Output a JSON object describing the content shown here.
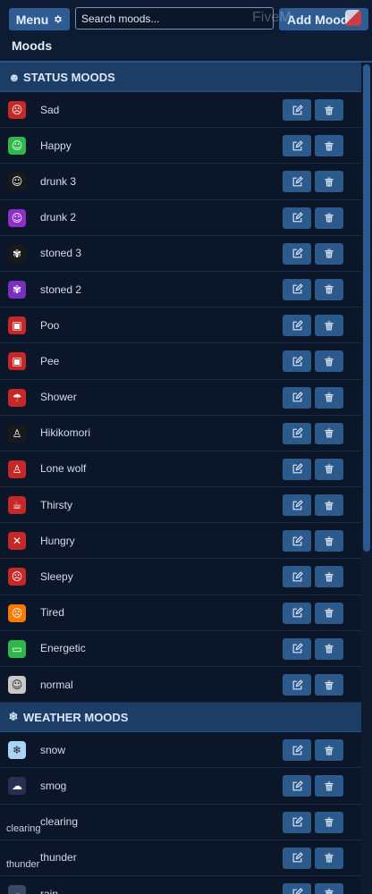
{
  "header": {
    "menu_label": "Menu",
    "search_placeholder": "Search moods...",
    "add_label": "Add Mood",
    "watermark": "FiveM",
    "page_title": "Moods"
  },
  "sections": [
    {
      "title": "STATUS MOODS",
      "icon": "smiley-icon",
      "moods": [
        {
          "name": "Sad",
          "icon": "sad-face-icon",
          "color": "#c62828",
          "glyph": "☹"
        },
        {
          "name": "Happy",
          "icon": "happy-face-icon",
          "color": "#2eb84a",
          "glyph": "☺"
        },
        {
          "name": "drunk 3",
          "icon": "drunk-face-icon",
          "color": "#1a1a1a",
          "glyph": "☺"
        },
        {
          "name": "drunk 2",
          "icon": "drunk-face-icon",
          "color": "#8e2fc8",
          "glyph": "☺"
        },
        {
          "name": "stoned 3",
          "icon": "leaf-icon",
          "color": "#1a1a1a",
          "glyph": "✾"
        },
        {
          "name": "stoned 2",
          "icon": "leaf-icon",
          "color": "#7b2fbf",
          "glyph": "✾"
        },
        {
          "name": "Poo",
          "icon": "toilet-icon",
          "color": "#c62828",
          "glyph": "▣"
        },
        {
          "name": "Pee",
          "icon": "toilet-icon",
          "color": "#c62828",
          "glyph": "▣"
        },
        {
          "name": "Shower",
          "icon": "shower-icon",
          "color": "#c62828",
          "glyph": "☂"
        },
        {
          "name": "Hikikomori",
          "icon": "hooded-figure-icon",
          "color": "#1a1a1a",
          "glyph": "♙"
        },
        {
          "name": "Lone wolf",
          "icon": "hooded-figure-icon",
          "color": "#c62828",
          "glyph": "♙"
        },
        {
          "name": "Thirsty",
          "icon": "cup-icon",
          "color": "#c62828",
          "glyph": "☕"
        },
        {
          "name": "Hungry",
          "icon": "utensils-icon",
          "color": "#c62828",
          "glyph": "✕"
        },
        {
          "name": "Sleepy",
          "icon": "sleepy-face-icon",
          "color": "#c62828",
          "glyph": "☹"
        },
        {
          "name": "Tired",
          "icon": "tired-face-icon",
          "color": "#f57c00",
          "glyph": "☹"
        },
        {
          "name": "Energetic",
          "icon": "battery-icon",
          "color": "#2eb84a",
          "glyph": "▭"
        },
        {
          "name": "normal",
          "icon": "neutral-face-icon",
          "color": "#c8c8c8",
          "glyph": "☺"
        }
      ]
    },
    {
      "title": "WEATHER MOODS",
      "icon": "snowflake-icon",
      "moods": [
        {
          "name": "snow",
          "icon": "snowflake-icon",
          "color": "#a9d4f5",
          "glyph": "❄",
          "broken": false
        },
        {
          "name": "smog",
          "icon": "cloud-icon",
          "color": "#2a2f52",
          "glyph": "☁",
          "broken": false
        },
        {
          "name": "clearing",
          "icon": "broken-image-icon",
          "color": "",
          "glyph": "",
          "broken": true,
          "alt": "clearing"
        },
        {
          "name": "thunder",
          "icon": "broken-image-icon",
          "color": "",
          "glyph": "",
          "broken": true,
          "alt": "thunder"
        },
        {
          "name": "rain",
          "icon": "rain-cloud-icon",
          "color": "#3a4a66",
          "glyph": "☁",
          "broken": false
        }
      ]
    }
  ],
  "colors": {
    "background": "#0b1628",
    "section_header": "#1c3d66",
    "button": "#2d5a8c",
    "accent": "#2e5c93"
  },
  "row_actions": {
    "edit_icon": "edit-icon",
    "delete_icon": "trash-icon"
  }
}
